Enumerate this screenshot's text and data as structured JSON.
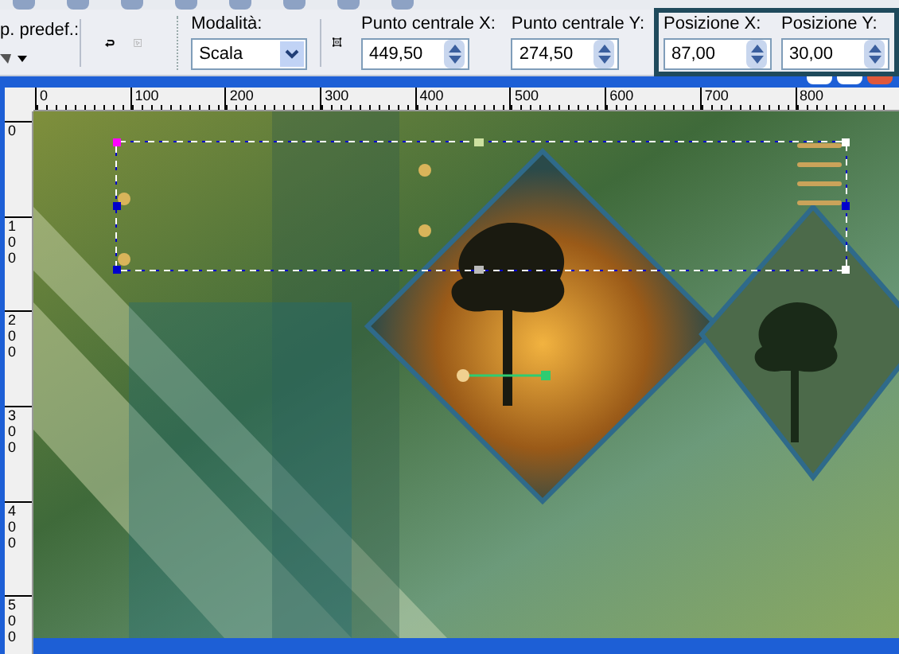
{
  "toolbar": {
    "preset_label": "p. predef.:",
    "mode": {
      "label": "Modalità:",
      "value": "Scala"
    },
    "fields": [
      {
        "label": "Punto centrale X:",
        "value": "449,50"
      },
      {
        "label": "Punto centrale Y:",
        "value": "274,50"
      }
    ],
    "position_group": {
      "highlighted": true,
      "fields": [
        {
          "label": "Posizione X:",
          "value": "87,00"
        },
        {
          "label": "Posizione Y:",
          "value": "30,00"
        }
      ]
    }
  },
  "rulers": {
    "horizontal": [
      "0",
      "100",
      "200",
      "300",
      "400",
      "500",
      "600",
      "700",
      "800"
    ],
    "vertical": [
      "0",
      "100",
      "200",
      "300",
      "400",
      "500"
    ]
  }
}
